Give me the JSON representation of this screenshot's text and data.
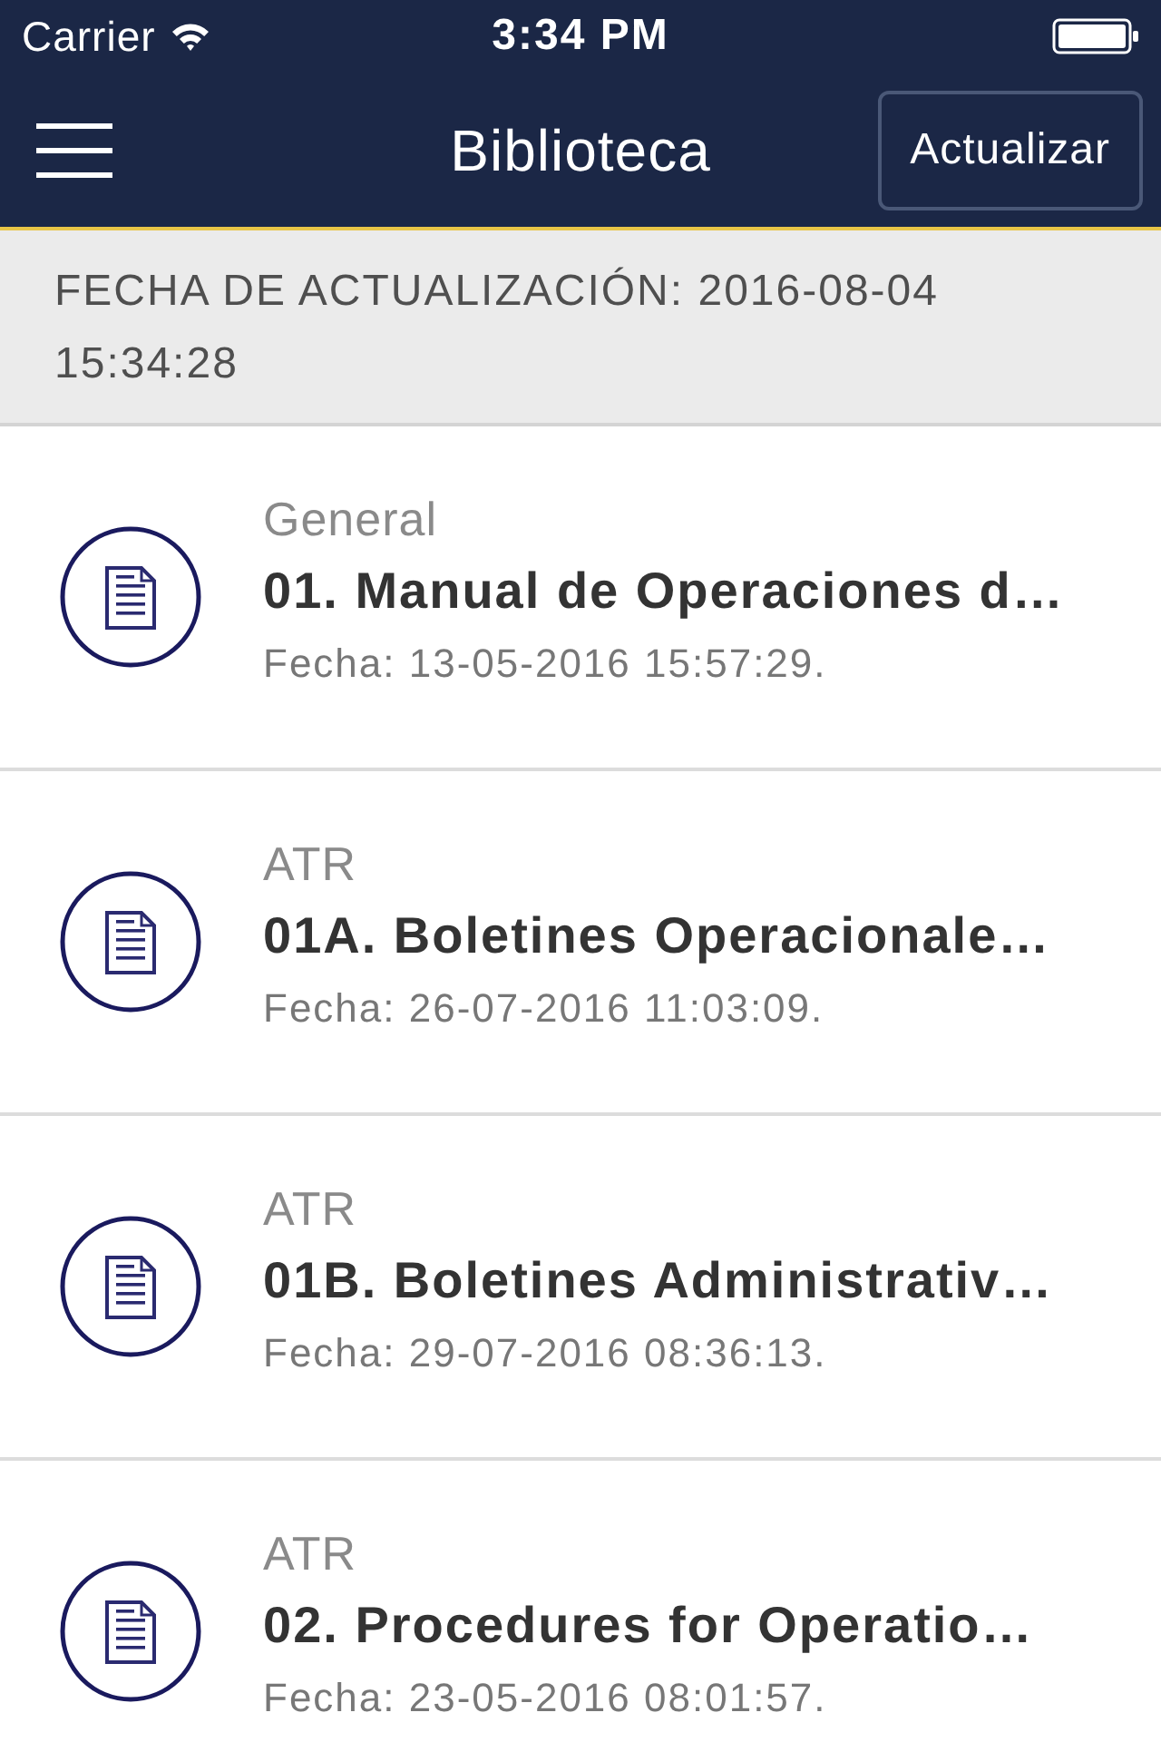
{
  "status_bar": {
    "carrier": "Carrier",
    "time": "3:34 PM"
  },
  "nav_bar": {
    "title": "Biblioteca",
    "action": "Actualizar"
  },
  "update_banner": {
    "text": "FECHA DE ACTUALIZACIÓN: 2016-08-04 15:34:28"
  },
  "documents": [
    {
      "category": "General",
      "title": "01. Manual de Operaciones d…",
      "date": "Fecha: 13-05-2016 15:57:29."
    },
    {
      "category": "ATR",
      "title": "01A. Boletines Operacionale…",
      "date": "Fecha: 26-07-2016 11:03:09."
    },
    {
      "category": "ATR",
      "title": "01B. Boletines Administrativ…",
      "date": "Fecha: 29-07-2016 08:36:13."
    },
    {
      "category": "ATR",
      "title": "02. Procedures for Operatio…",
      "date": "Fecha: 23-05-2016 08:01:57."
    }
  ]
}
